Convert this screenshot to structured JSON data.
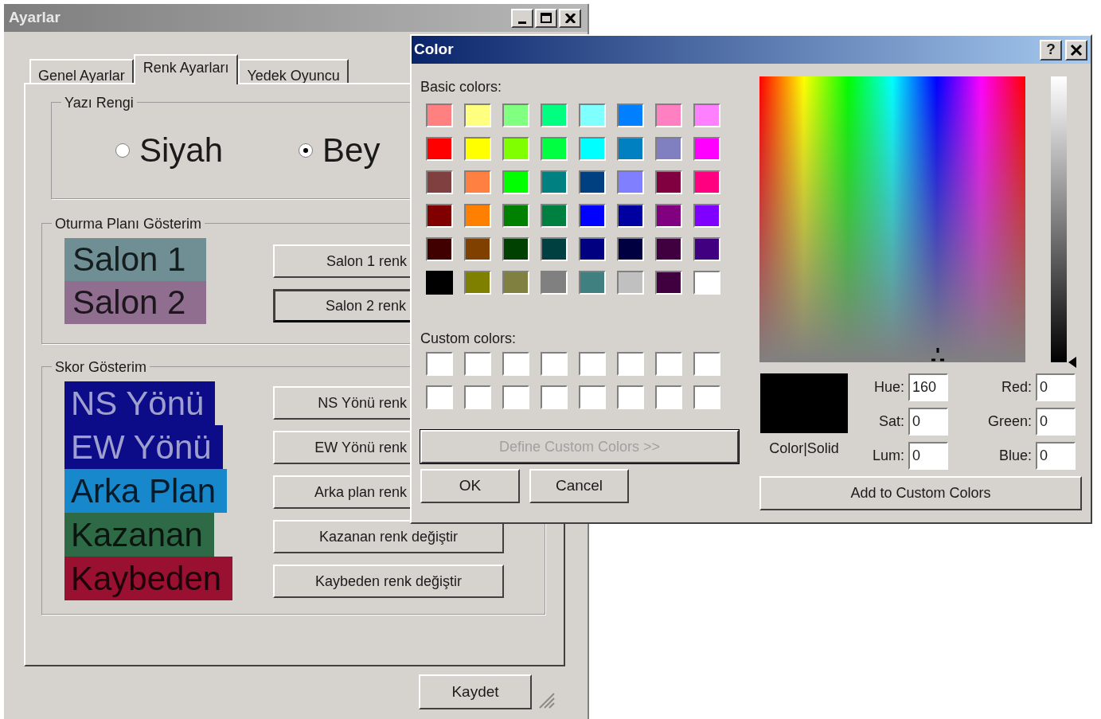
{
  "main_window": {
    "title": "Ayarlar",
    "tabs": [
      {
        "label": "Genel Ayarlar",
        "selected": false
      },
      {
        "label": "Renk Ayarları",
        "selected": true
      },
      {
        "label": "Yedek Oyuncu",
        "selected": false
      }
    ],
    "text_color_group": {
      "title": "Yazı Rengi",
      "options": [
        {
          "label": "Siyah",
          "selected": false
        },
        {
          "label": "Bey",
          "selected": true
        }
      ]
    },
    "seating_group": {
      "title": "Oturma Planı Gösterim",
      "items": [
        {
          "label": "Salon 1",
          "color": "#6f8f94",
          "button": "Salon 1 renk",
          "focused": false
        },
        {
          "label": "Salon 2",
          "color": "#8f6e90",
          "button": "Salon 2 renk",
          "focused": true
        }
      ]
    },
    "score_group": {
      "title": "Skor Gösterim",
      "items": [
        {
          "label": "NS Yönü",
          "color": "#0c0c88",
          "button": "NS Yönü renk"
        },
        {
          "label": "EW Yönü",
          "color": "#0c0c88",
          "button": "EW Yönü renk"
        },
        {
          "label": "Arka Plan",
          "color": "#1888cc",
          "button": "Arka plan renk"
        },
        {
          "label": "Kazanan",
          "color": "#2f6a47",
          "button": "Kazanan renk değiştir"
        },
        {
          "label": "Kaybeden",
          "color": "#9a1030",
          "button": "Kaybeden renk değiştir"
        }
      ]
    },
    "save_button": "Kaydet"
  },
  "color_dialog": {
    "title": "Color",
    "help_button": "?",
    "basic_colors_label": "Basic colors:",
    "basic_colors": [
      {
        "color": "#ff8080",
        "selected": false
      },
      {
        "color": "#ffff80",
        "selected": false
      },
      {
        "color": "#80ff80",
        "selected": false
      },
      {
        "color": "#00ff80",
        "selected": false
      },
      {
        "color": "#80ffff",
        "selected": false
      },
      {
        "color": "#0080ff",
        "selected": false
      },
      {
        "color": "#ff80c0",
        "selected": false
      },
      {
        "color": "#ff80ff",
        "selected": false
      },
      {
        "color": "#ff0000",
        "selected": false
      },
      {
        "color": "#ffff00",
        "selected": false
      },
      {
        "color": "#80ff00",
        "selected": false
      },
      {
        "color": "#00ff40",
        "selected": false
      },
      {
        "color": "#00ffff",
        "selected": false
      },
      {
        "color": "#0080c0",
        "selected": false
      },
      {
        "color": "#8080c0",
        "selected": false
      },
      {
        "color": "#ff00ff",
        "selected": false
      },
      {
        "color": "#804040",
        "selected": false
      },
      {
        "color": "#ff8040",
        "selected": false
      },
      {
        "color": "#00ff00",
        "selected": false
      },
      {
        "color": "#008080",
        "selected": false
      },
      {
        "color": "#004080",
        "selected": false
      },
      {
        "color": "#8080ff",
        "selected": false
      },
      {
        "color": "#800040",
        "selected": false
      },
      {
        "color": "#ff0080",
        "selected": false
      },
      {
        "color": "#800000",
        "selected": false
      },
      {
        "color": "#ff8000",
        "selected": false
      },
      {
        "color": "#008000",
        "selected": false
      },
      {
        "color": "#008040",
        "selected": false
      },
      {
        "color": "#0000ff",
        "selected": false
      },
      {
        "color": "#0000a0",
        "selected": false
      },
      {
        "color": "#800080",
        "selected": false
      },
      {
        "color": "#8000ff",
        "selected": false
      },
      {
        "color": "#400000",
        "selected": false
      },
      {
        "color": "#804000",
        "selected": false
      },
      {
        "color": "#004000",
        "selected": false
      },
      {
        "color": "#004040",
        "selected": false
      },
      {
        "color": "#000080",
        "selected": false
      },
      {
        "color": "#000040",
        "selected": false
      },
      {
        "color": "#400040",
        "selected": false
      },
      {
        "color": "#400080",
        "selected": false
      },
      {
        "color": "#000000",
        "selected": true
      },
      {
        "color": "#808000",
        "selected": false
      },
      {
        "color": "#808040",
        "selected": false
      },
      {
        "color": "#808080",
        "selected": false
      },
      {
        "color": "#408080",
        "selected": false
      },
      {
        "color": "#c0c0c0",
        "selected": false
      },
      {
        "color": "#400040",
        "selected": false
      },
      {
        "color": "#ffffff",
        "selected": false
      }
    ],
    "custom_colors_label": "Custom colors:",
    "custom_colors": [
      {
        "color": "#ffffff"
      },
      {
        "color": "#ffffff"
      },
      {
        "color": "#ffffff"
      },
      {
        "color": "#ffffff"
      },
      {
        "color": "#ffffff"
      },
      {
        "color": "#ffffff"
      },
      {
        "color": "#ffffff"
      },
      {
        "color": "#ffffff"
      },
      {
        "color": "#ffffff"
      },
      {
        "color": "#ffffff"
      },
      {
        "color": "#ffffff"
      },
      {
        "color": "#ffffff"
      },
      {
        "color": "#ffffff"
      },
      {
        "color": "#ffffff"
      },
      {
        "color": "#ffffff"
      },
      {
        "color": "#ffffff"
      }
    ],
    "define_button": {
      "label": "Define Custom Colors >>",
      "disabled": true
    },
    "ok_button": "OK",
    "cancel_button": "Cancel",
    "preview_label": "Color|Solid",
    "fields": [
      {
        "label": "Hue:",
        "value": "160"
      },
      {
        "label": "Red:",
        "value": "0"
      },
      {
        "label": "Sat:",
        "value": "0"
      },
      {
        "label": "Green:",
        "value": "0"
      },
      {
        "label": "Lum:",
        "value": "0"
      },
      {
        "label": "Blue:",
        "value": "0"
      }
    ],
    "add_button": "Add to Custom Colors"
  }
}
